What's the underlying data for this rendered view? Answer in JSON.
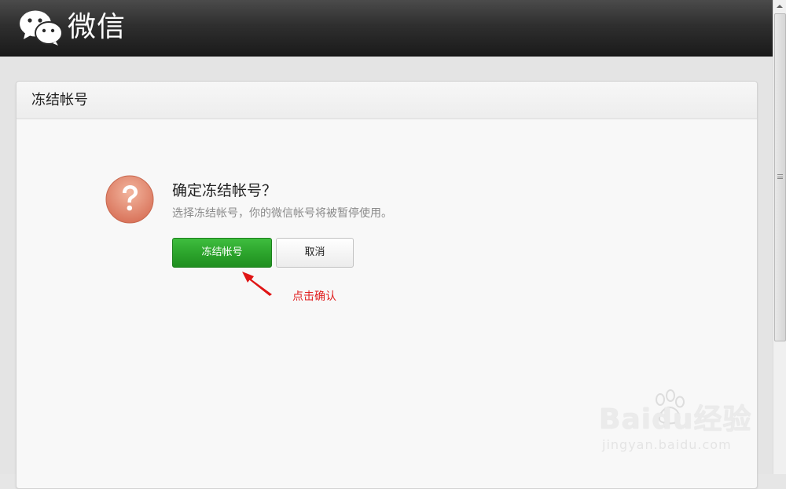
{
  "app": {
    "name": "微信",
    "logo_icon": "wechat-logo-icon"
  },
  "card": {
    "title": "冻结帐号"
  },
  "dialog": {
    "icon": "question-icon",
    "title": "确定冻结帐号？",
    "description": "选择冻结帐号，你的微信帐号将被暂停使用。",
    "confirm_label": "冻结帐号",
    "cancel_label": "取消"
  },
  "annotation": {
    "text": "点击确认",
    "icon": "red-arrow-icon"
  },
  "watermark": {
    "main": "Baidu经验",
    "sub": "jingyan.baidu.com"
  },
  "colors": {
    "primary_green": "#2ba32b",
    "annotation_red": "#e02020",
    "warning_icon": "#e08a6c"
  }
}
